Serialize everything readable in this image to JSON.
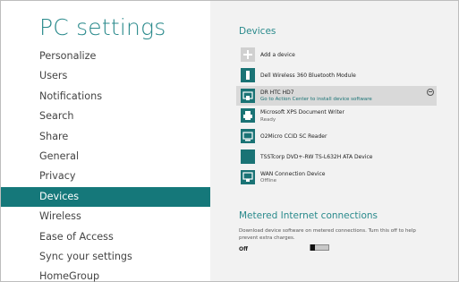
{
  "app": {
    "title": "PC settings"
  },
  "nav": {
    "items": [
      {
        "label": "Personalize",
        "selected": false
      },
      {
        "label": "Users",
        "selected": false
      },
      {
        "label": "Notifications",
        "selected": false
      },
      {
        "label": "Search",
        "selected": false
      },
      {
        "label": "Share",
        "selected": false
      },
      {
        "label": "General",
        "selected": false
      },
      {
        "label": "Privacy",
        "selected": false
      },
      {
        "label": "Devices",
        "selected": true
      },
      {
        "label": "Wireless",
        "selected": false
      },
      {
        "label": "Ease of Access",
        "selected": false
      },
      {
        "label": "Sync your settings",
        "selected": false
      },
      {
        "label": "HomeGroup",
        "selected": false
      }
    ]
  },
  "devices": {
    "heading": "Devices",
    "add_label": "Add a device",
    "list": [
      {
        "name": "Dell Wireless 360 Bluetooth Module",
        "status": "",
        "icon": "bluetooth-module-icon"
      },
      {
        "name": "DR HTC HD7",
        "status": "Go to Action Center to install device software",
        "icon": "phone-device-icon",
        "selected": true
      },
      {
        "name": "Microsoft XPS Document Writer",
        "status": "Ready",
        "icon": "printer-icon"
      },
      {
        "name": "O2Micro CCID SC Reader",
        "status": "",
        "icon": "card-reader-icon"
      },
      {
        "name": "TSSTcorp DVD+-RW TS-L632H ATA Device",
        "status": "",
        "icon": "dvd-drive-icon"
      },
      {
        "name": "WAN Connection Device",
        "status": "Offline",
        "icon": "wan-device-icon"
      }
    ]
  },
  "metered": {
    "heading": "Metered Internet connections",
    "description": "Download device software on metered connections. Turn this off to help prevent extra charges.",
    "toggle_label": "Off",
    "toggle_on": false
  },
  "colors": {
    "accent": "#2a8a8c",
    "nav_selected": "#15787a",
    "tile": "#1a7375"
  }
}
